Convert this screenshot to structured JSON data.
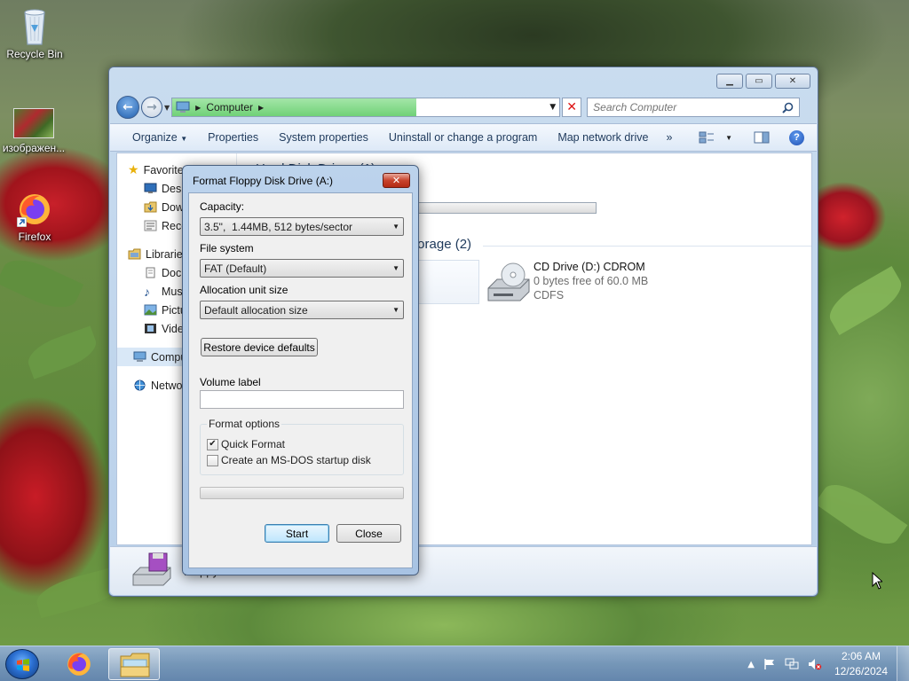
{
  "desktop": {
    "icons": [
      {
        "label": "Recycle Bin",
        "icon": "recycle-bin-icon"
      },
      {
        "label": "изображен...",
        "icon": "image-file-icon"
      },
      {
        "label": "Firefox",
        "icon": "firefox-icon"
      }
    ]
  },
  "explorer": {
    "address": "Computer",
    "search_placeholder": "Search Computer",
    "toolbar": {
      "organize": "Organize",
      "properties": "Properties",
      "system_properties": "System properties",
      "uninstall": "Uninstall or change a program",
      "map_drive": "Map network drive",
      "more": "»"
    },
    "nav": {
      "favorites": "Favorites",
      "desktop": "Desktop",
      "downloads": "Downloads",
      "recent": "Recent Places",
      "libraries": "Libraries",
      "documents": "Documents",
      "music": "Music",
      "pictures": "Pictures",
      "videos": "Videos",
      "computer": "Computer",
      "network": "Network"
    },
    "content": {
      "hdd_header": "Hard Disk Drives (1)",
      "hdd_free_fragment": "B",
      "removable_header": "Storage (2)",
      "cd_name": "CD Drive (D:) CDROM",
      "cd_free": "0 bytes free of 60.0 MB",
      "cd_fs": "CDFS"
    },
    "details_text": "Floppy Disk Drive"
  },
  "format_dialog": {
    "title": "Format Floppy Disk Drive (A:)",
    "capacity_label": "Capacity:",
    "capacity_value": "3.5\",  1.44MB, 512 bytes/sector",
    "filesystem_label": "File system",
    "filesystem_value": "FAT (Default)",
    "alloc_label": "Allocation unit size",
    "alloc_value": "Default allocation size",
    "restore_button": "Restore device defaults",
    "volume_label": "Volume label",
    "volume_value": "",
    "format_options_label": "Format options",
    "quick_format_label": "Quick Format",
    "quick_format_checked": true,
    "msdos_label": "Create an MS-DOS startup disk",
    "msdos_checked": false,
    "progress": 0,
    "start_button": "Start",
    "close_button": "Close"
  },
  "taskbar": {
    "time": "2:06 AM",
    "date": "12/26/2024"
  },
  "colors": {
    "accent": "#1f5fae",
    "address_progress": "#70d177",
    "close_red": "#c8432c"
  }
}
